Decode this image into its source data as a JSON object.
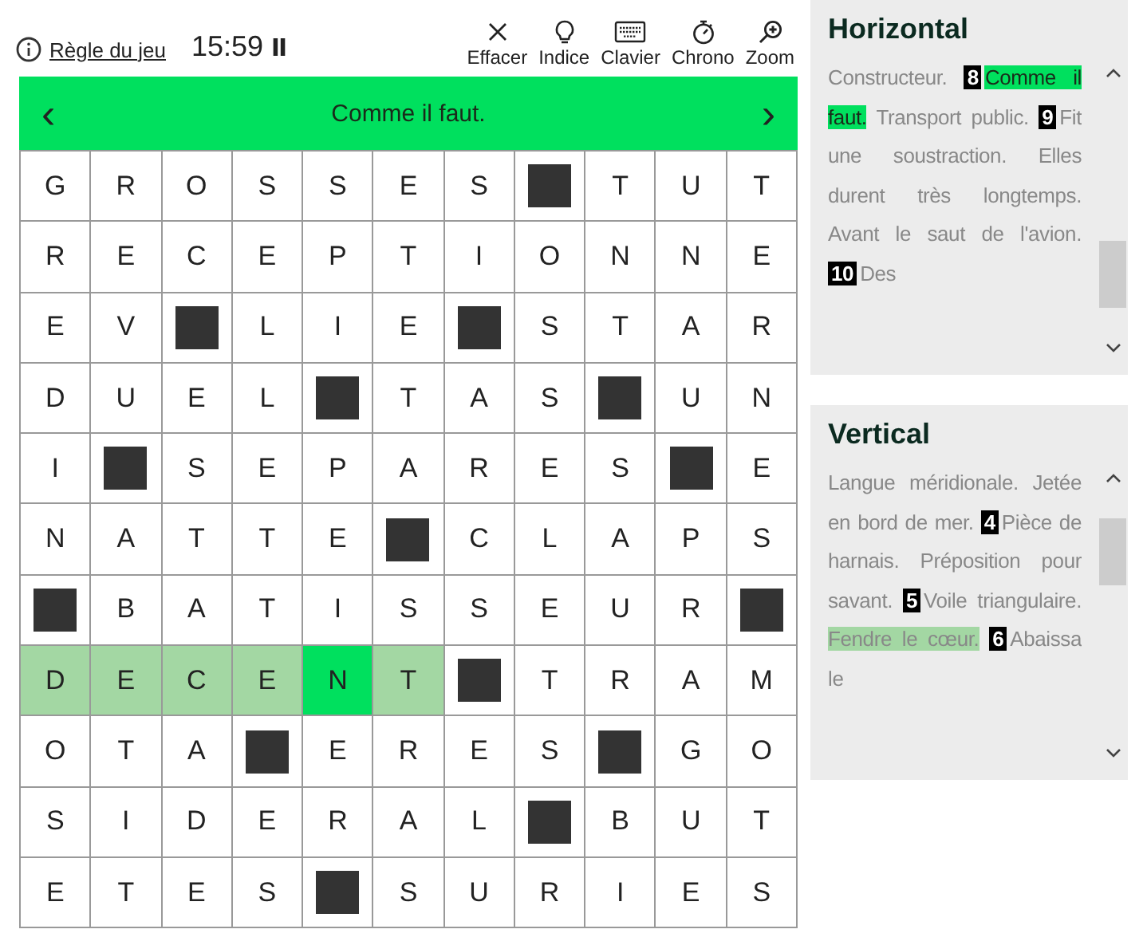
{
  "header": {
    "rules_link": "Règle du jeu",
    "timer": "15:59",
    "paused": false,
    "tools": [
      {
        "kind": "clear",
        "label": "Effacer"
      },
      {
        "kind": "hint",
        "label": "Indice"
      },
      {
        "kind": "keyboard",
        "label": "Clavier"
      },
      {
        "kind": "timer",
        "label": "Chrono"
      },
      {
        "kind": "zoom",
        "label": "Zoom"
      }
    ]
  },
  "clue_bar": {
    "prev": "‹",
    "text": "Comme il faut.",
    "next": "›"
  },
  "grid": [
    [
      {
        "kind": "letter",
        "letter": "G",
        "selected": false,
        "in_word": false
      },
      {
        "kind": "letter",
        "letter": "R",
        "selected": false,
        "in_word": false
      },
      {
        "kind": "letter",
        "letter": "O",
        "selected": false,
        "in_word": false
      },
      {
        "kind": "letter",
        "letter": "S",
        "selected": false,
        "in_word": false
      },
      {
        "kind": "letter",
        "letter": "S",
        "selected": false,
        "in_word": false
      },
      {
        "kind": "letter",
        "letter": "E",
        "selected": false,
        "in_word": false
      },
      {
        "kind": "letter",
        "letter": "S",
        "selected": false,
        "in_word": false
      },
      {
        "kind": "block"
      },
      {
        "kind": "letter",
        "letter": "T",
        "selected": false,
        "in_word": false
      },
      {
        "kind": "letter",
        "letter": "U",
        "selected": false,
        "in_word": false
      },
      {
        "kind": "letter",
        "letter": "T",
        "selected": false,
        "in_word": false
      }
    ],
    [
      {
        "kind": "letter",
        "letter": "R",
        "selected": false,
        "in_word": false
      },
      {
        "kind": "letter",
        "letter": "E",
        "selected": false,
        "in_word": false
      },
      {
        "kind": "letter",
        "letter": "C",
        "selected": false,
        "in_word": false
      },
      {
        "kind": "letter",
        "letter": "E",
        "selected": false,
        "in_word": false
      },
      {
        "kind": "letter",
        "letter": "P",
        "selected": false,
        "in_word": false
      },
      {
        "kind": "letter",
        "letter": "T",
        "selected": false,
        "in_word": false
      },
      {
        "kind": "letter",
        "letter": "I",
        "selected": false,
        "in_word": false
      },
      {
        "kind": "letter",
        "letter": "O",
        "selected": false,
        "in_word": false
      },
      {
        "kind": "letter",
        "letter": "N",
        "selected": false,
        "in_word": false
      },
      {
        "kind": "letter",
        "letter": "N",
        "selected": false,
        "in_word": false
      },
      {
        "kind": "letter",
        "letter": "E",
        "selected": false,
        "in_word": false
      }
    ],
    [
      {
        "kind": "letter",
        "letter": "E",
        "selected": false,
        "in_word": false
      },
      {
        "kind": "letter",
        "letter": "V",
        "selected": false,
        "in_word": false
      },
      {
        "kind": "block"
      },
      {
        "kind": "letter",
        "letter": "L",
        "selected": false,
        "in_word": false
      },
      {
        "kind": "letter",
        "letter": "I",
        "selected": false,
        "in_word": false
      },
      {
        "kind": "letter",
        "letter": "E",
        "selected": false,
        "in_word": false
      },
      {
        "kind": "block"
      },
      {
        "kind": "letter",
        "letter": "S",
        "selected": false,
        "in_word": false
      },
      {
        "kind": "letter",
        "letter": "T",
        "selected": false,
        "in_word": false
      },
      {
        "kind": "letter",
        "letter": "A",
        "selected": false,
        "in_word": false
      },
      {
        "kind": "letter",
        "letter": "R",
        "selected": false,
        "in_word": false
      }
    ],
    [
      {
        "kind": "letter",
        "letter": "D",
        "selected": false,
        "in_word": false
      },
      {
        "kind": "letter",
        "letter": "U",
        "selected": false,
        "in_word": false
      },
      {
        "kind": "letter",
        "letter": "E",
        "selected": false,
        "in_word": false
      },
      {
        "kind": "letter",
        "letter": "L",
        "selected": false,
        "in_word": false
      },
      {
        "kind": "block"
      },
      {
        "kind": "letter",
        "letter": "T",
        "selected": false,
        "in_word": false
      },
      {
        "kind": "letter",
        "letter": "A",
        "selected": false,
        "in_word": false
      },
      {
        "kind": "letter",
        "letter": "S",
        "selected": false,
        "in_word": false
      },
      {
        "kind": "block"
      },
      {
        "kind": "letter",
        "letter": "U",
        "selected": false,
        "in_word": false
      },
      {
        "kind": "letter",
        "letter": "N",
        "selected": false,
        "in_word": false
      }
    ],
    [
      {
        "kind": "letter",
        "letter": "I",
        "selected": false,
        "in_word": false
      },
      {
        "kind": "block"
      },
      {
        "kind": "letter",
        "letter": "S",
        "selected": false,
        "in_word": false
      },
      {
        "kind": "letter",
        "letter": "E",
        "selected": false,
        "in_word": false
      },
      {
        "kind": "letter",
        "letter": "P",
        "selected": false,
        "in_word": false
      },
      {
        "kind": "letter",
        "letter": "A",
        "selected": false,
        "in_word": false
      },
      {
        "kind": "letter",
        "letter": "R",
        "selected": false,
        "in_word": false
      },
      {
        "kind": "letter",
        "letter": "E",
        "selected": false,
        "in_word": false
      },
      {
        "kind": "letter",
        "letter": "S",
        "selected": false,
        "in_word": false
      },
      {
        "kind": "block"
      },
      {
        "kind": "letter",
        "letter": "E",
        "selected": false,
        "in_word": false
      }
    ],
    [
      {
        "kind": "letter",
        "letter": "N",
        "selected": false,
        "in_word": false
      },
      {
        "kind": "letter",
        "letter": "A",
        "selected": false,
        "in_word": false
      },
      {
        "kind": "letter",
        "letter": "T",
        "selected": false,
        "in_word": false
      },
      {
        "kind": "letter",
        "letter": "T",
        "selected": false,
        "in_word": false
      },
      {
        "kind": "letter",
        "letter": "E",
        "selected": false,
        "in_word": false
      },
      {
        "kind": "block"
      },
      {
        "kind": "letter",
        "letter": "C",
        "selected": false,
        "in_word": false
      },
      {
        "kind": "letter",
        "letter": "L",
        "selected": false,
        "in_word": false
      },
      {
        "kind": "letter",
        "letter": "A",
        "selected": false,
        "in_word": false
      },
      {
        "kind": "letter",
        "letter": "P",
        "selected": false,
        "in_word": false
      },
      {
        "kind": "letter",
        "letter": "S",
        "selected": false,
        "in_word": false
      }
    ],
    [
      {
        "kind": "block"
      },
      {
        "kind": "letter",
        "letter": "B",
        "selected": false,
        "in_word": false
      },
      {
        "kind": "letter",
        "letter": "A",
        "selected": false,
        "in_word": false
      },
      {
        "kind": "letter",
        "letter": "T",
        "selected": false,
        "in_word": false
      },
      {
        "kind": "letter",
        "letter": "I",
        "selected": false,
        "in_word": false
      },
      {
        "kind": "letter",
        "letter": "S",
        "selected": false,
        "in_word": false
      },
      {
        "kind": "letter",
        "letter": "S",
        "selected": false,
        "in_word": false
      },
      {
        "kind": "letter",
        "letter": "E",
        "selected": false,
        "in_word": false
      },
      {
        "kind": "letter",
        "letter": "U",
        "selected": false,
        "in_word": false
      },
      {
        "kind": "letter",
        "letter": "R",
        "selected": false,
        "in_word": false
      },
      {
        "kind": "block"
      }
    ],
    [
      {
        "kind": "letter",
        "letter": "D",
        "selected": false,
        "in_word": true
      },
      {
        "kind": "letter",
        "letter": "E",
        "selected": false,
        "in_word": true
      },
      {
        "kind": "letter",
        "letter": "C",
        "selected": false,
        "in_word": true
      },
      {
        "kind": "letter",
        "letter": "E",
        "selected": false,
        "in_word": true
      },
      {
        "kind": "letter",
        "letter": "N",
        "selected": true,
        "in_word": true
      },
      {
        "kind": "letter",
        "letter": "T",
        "selected": false,
        "in_word": true
      },
      {
        "kind": "block"
      },
      {
        "kind": "letter",
        "letter": "T",
        "selected": false,
        "in_word": false
      },
      {
        "kind": "letter",
        "letter": "R",
        "selected": false,
        "in_word": false
      },
      {
        "kind": "letter",
        "letter": "A",
        "selected": false,
        "in_word": false
      },
      {
        "kind": "letter",
        "letter": "M",
        "selected": false,
        "in_word": false
      }
    ],
    [
      {
        "kind": "letter",
        "letter": "O",
        "selected": false,
        "in_word": false
      },
      {
        "kind": "letter",
        "letter": "T",
        "selected": false,
        "in_word": false
      },
      {
        "kind": "letter",
        "letter": "A",
        "selected": false,
        "in_word": false
      },
      {
        "kind": "block"
      },
      {
        "kind": "letter",
        "letter": "E",
        "selected": false,
        "in_word": false
      },
      {
        "kind": "letter",
        "letter": "R",
        "selected": false,
        "in_word": false
      },
      {
        "kind": "letter",
        "letter": "E",
        "selected": false,
        "in_word": false
      },
      {
        "kind": "letter",
        "letter": "S",
        "selected": false,
        "in_word": false
      },
      {
        "kind": "block"
      },
      {
        "kind": "letter",
        "letter": "G",
        "selected": false,
        "in_word": false
      },
      {
        "kind": "letter",
        "letter": "O",
        "selected": false,
        "in_word": false
      }
    ],
    [
      {
        "kind": "letter",
        "letter": "S",
        "selected": false,
        "in_word": false
      },
      {
        "kind": "letter",
        "letter": "I",
        "selected": false,
        "in_word": false
      },
      {
        "kind": "letter",
        "letter": "D",
        "selected": false,
        "in_word": false
      },
      {
        "kind": "letter",
        "letter": "E",
        "selected": false,
        "in_word": false
      },
      {
        "kind": "letter",
        "letter": "R",
        "selected": false,
        "in_word": false
      },
      {
        "kind": "letter",
        "letter": "A",
        "selected": false,
        "in_word": false
      },
      {
        "kind": "letter",
        "letter": "L",
        "selected": false,
        "in_word": false
      },
      {
        "kind": "block"
      },
      {
        "kind": "letter",
        "letter": "B",
        "selected": false,
        "in_word": false
      },
      {
        "kind": "letter",
        "letter": "U",
        "selected": false,
        "in_word": false
      },
      {
        "kind": "letter",
        "letter": "T",
        "selected": false,
        "in_word": false
      }
    ],
    [
      {
        "kind": "letter",
        "letter": "E",
        "selected": false,
        "in_word": false
      },
      {
        "kind": "letter",
        "letter": "T",
        "selected": false,
        "in_word": false
      },
      {
        "kind": "letter",
        "letter": "E",
        "selected": false,
        "in_word": false
      },
      {
        "kind": "letter",
        "letter": "S",
        "selected": false,
        "in_word": false
      },
      {
        "kind": "block"
      },
      {
        "kind": "letter",
        "letter": "S",
        "selected": false,
        "in_word": false
      },
      {
        "kind": "letter",
        "letter": "U",
        "selected": false,
        "in_word": false
      },
      {
        "kind": "letter",
        "letter": "R",
        "selected": false,
        "in_word": false
      },
      {
        "kind": "letter",
        "letter": "I",
        "selected": false,
        "in_word": false
      },
      {
        "kind": "letter",
        "letter": "E",
        "selected": false,
        "in_word": false
      },
      {
        "kind": "letter",
        "letter": "S",
        "selected": false,
        "in_word": false
      }
    ]
  ],
  "clue_panels": [
    {
      "title": "Horizontal",
      "parts": [
        {
          "text": "Constructeur.",
          "selected": false,
          "crossing": false
        },
        {
          "number": "8",
          "text": "Comme il faut.",
          "selected": true,
          "crossing": false
        },
        {
          "text": "Transport public.",
          "selected": false,
          "crossing": false
        },
        {
          "number": "9",
          "text": "Fit une soustraction.",
          "selected": false,
          "crossing": false
        },
        {
          "text": "Elles durent très longtemps.",
          "selected": false,
          "crossing": false
        },
        {
          "text": "Avant le saut de l'avion.",
          "selected": false,
          "crossing": false
        },
        {
          "number": "10",
          "text": "Des",
          "selected": false,
          "crossing": false
        }
      ]
    },
    {
      "title": "Vertical",
      "parts": [
        {
          "text": "Langue méridionale.",
          "selected": false,
          "crossing": false
        },
        {
          "text": "Jetée en bord de mer.",
          "selected": false,
          "crossing": false
        },
        {
          "number": "4",
          "text": "Pièce de harnais.",
          "selected": false,
          "crossing": false
        },
        {
          "text": "Préposition pour savant.",
          "selected": false,
          "crossing": false
        },
        {
          "number": "5",
          "text": "Voile triangulaire.",
          "selected": false,
          "crossing": false
        },
        {
          "text": "Fendre le cœur.",
          "selected": false,
          "crossing": true
        },
        {
          "number": "6",
          "text": "Abaissa le",
          "selected": false,
          "crossing": false
        }
      ]
    }
  ]
}
